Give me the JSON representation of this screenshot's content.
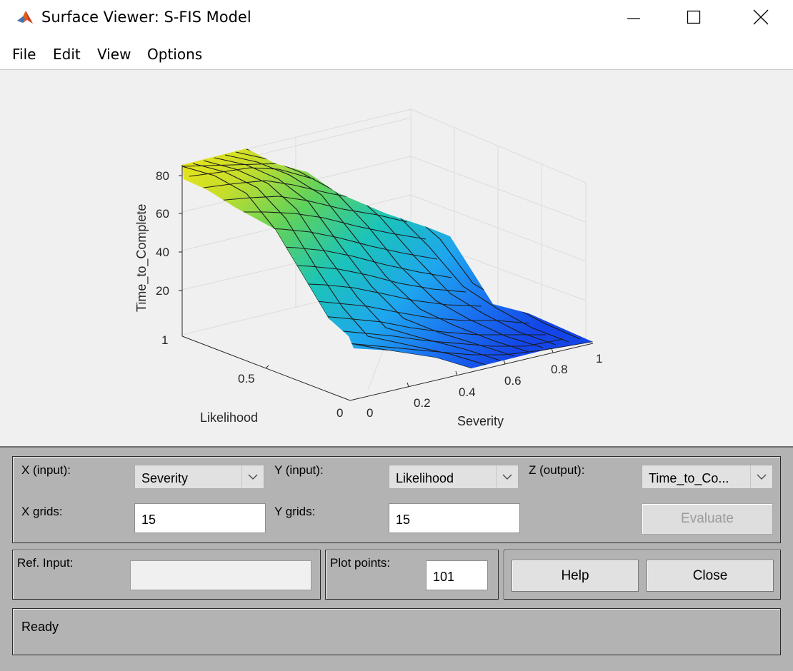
{
  "window": {
    "title": "Surface Viewer: S-FIS Model"
  },
  "menu": [
    "File",
    "Edit",
    "View",
    "Options"
  ],
  "plot": {
    "zlabel": "Time_to_Complete",
    "xlabel": "Severity",
    "ylabel": "Likelihood",
    "z_ticks": [
      "20",
      "40",
      "60",
      "80"
    ],
    "x_ticks": [
      "0",
      "0.2",
      "0.4",
      "0.6",
      "0.8",
      "1"
    ],
    "y_ticks": [
      "0",
      "0.5",
      "1"
    ]
  },
  "controls": {
    "x_input_label": "X (input):",
    "x_input_value": "Severity",
    "y_input_label": "Y (input):",
    "y_input_value": "Likelihood",
    "z_output_label": "Z (output):",
    "z_output_value": "Time_to_Co...",
    "x_grids_label": "X grids:",
    "x_grids_value": "15",
    "y_grids_label": "Y grids:",
    "y_grids_value": "15",
    "evaluate_label": "Evaluate",
    "ref_input_label": "Ref. Input:",
    "plot_points_label": "Plot points:",
    "plot_points_value": "101",
    "help_label": "Help",
    "close_label": "Close"
  },
  "status": {
    "text": "Ready"
  }
}
